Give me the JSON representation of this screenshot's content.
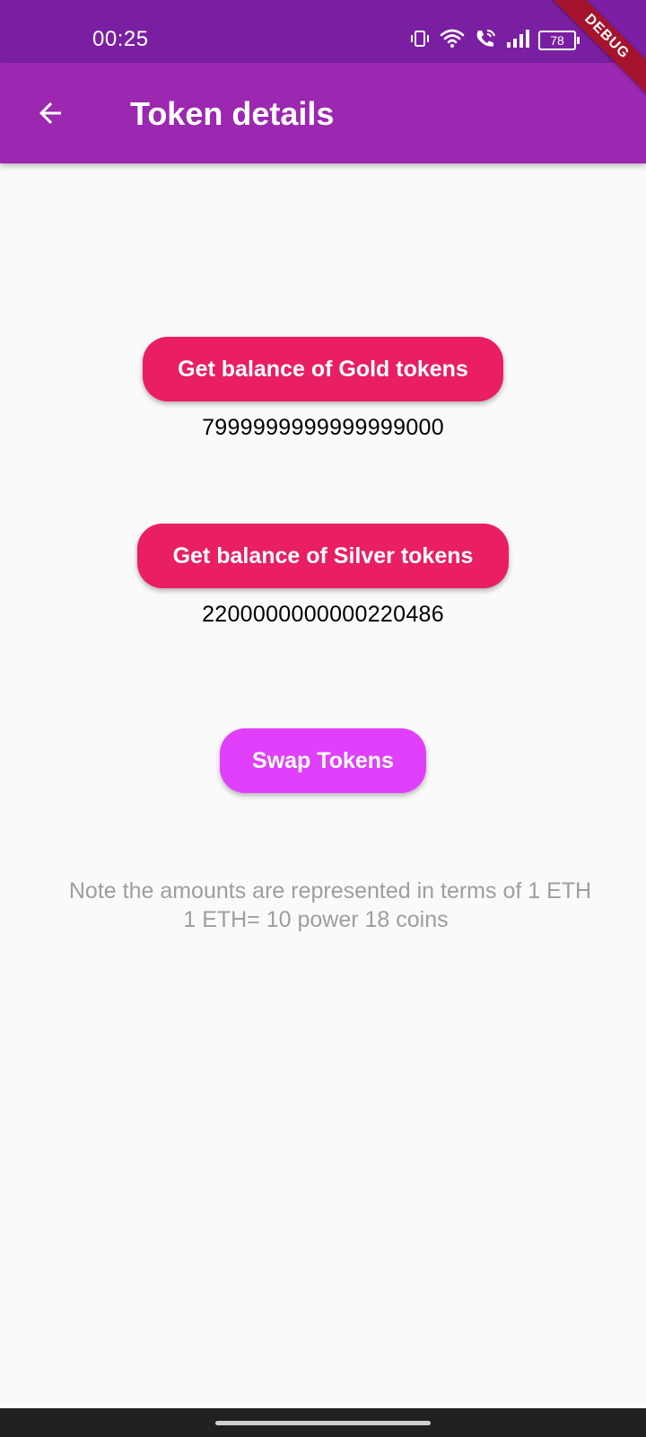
{
  "status_bar": {
    "time": "00:25",
    "battery": "78",
    "icons": [
      "vibrate-icon",
      "wifi-icon",
      "wifi-call-icon",
      "signal-icon",
      "battery-icon"
    ]
  },
  "debug_banner": "DEBUG",
  "app_bar": {
    "title": "Token details",
    "back_icon": "arrow-back-icon"
  },
  "gold": {
    "button_label": "Get balance of Gold tokens",
    "balance": "7999999999999999000"
  },
  "silver": {
    "button_label": "Get balance of Silver tokens",
    "balance": "2200000000000220486"
  },
  "swap": {
    "button_label": "Swap Tokens"
  },
  "note": {
    "line1": "Note the amounts are represented in terms of 1 ETH",
    "line2": "1 ETH= 10 power 18 coins"
  },
  "colors": {
    "status_bar": "#7b1fa2",
    "app_bar": "#9c27b0",
    "primary_button": "#e91e63",
    "swap_button": "#e040fb",
    "note_text": "#9e9e9e",
    "debug_banner": "#a5142c"
  }
}
